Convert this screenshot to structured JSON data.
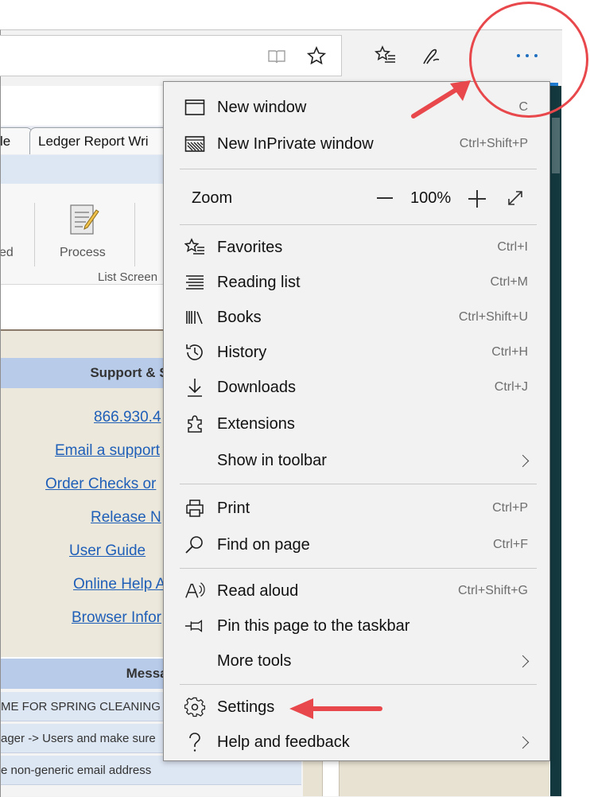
{
  "tabs": [
    {
      "label": "le"
    },
    {
      "label": "Ledger Report Wri"
    }
  ],
  "ribbon": {
    "items": [
      {
        "label": "ed"
      },
      {
        "label": "Process"
      }
    ],
    "group_label": "List Screen"
  },
  "support": {
    "header": "Support & Se",
    "links": [
      {
        "label": "866.930.4"
      },
      {
        "label": "Email a support"
      },
      {
        "label": "Order Checks or"
      },
      {
        "label": "Release N"
      },
      {
        "label": "User Guide"
      },
      {
        "label": "Online Help A"
      },
      {
        "label": "Browser Infor"
      }
    ]
  },
  "messages": {
    "header": "Messag",
    "lines": [
      {
        "text": "ME FOR SPRING CLEANING"
      },
      {
        "text": "ager -> Users and make sure"
      },
      {
        "text": "e non-generic email address"
      }
    ]
  },
  "menu": {
    "items_top": [
      {
        "label": "New window",
        "shortcut": "C",
        "icon": "window-icon"
      },
      {
        "label": "New InPrivate window",
        "shortcut": "Ctrl+Shift+P",
        "icon": "inprivate-icon"
      }
    ],
    "zoom": {
      "label": "Zoom",
      "value": "100%"
    },
    "items_mid": [
      {
        "label": "Favorites",
        "shortcut": "Ctrl+I",
        "icon": "favorites-icon"
      },
      {
        "label": "Reading list",
        "shortcut": "Ctrl+M",
        "icon": "reading-list-icon"
      },
      {
        "label": "Books",
        "shortcut": "Ctrl+Shift+U",
        "icon": "books-icon"
      },
      {
        "label": "History",
        "shortcut": "Ctrl+H",
        "icon": "history-icon"
      },
      {
        "label": "Downloads",
        "shortcut": "Ctrl+J",
        "icon": "download-icon"
      },
      {
        "label": "Extensions",
        "shortcut": "",
        "icon": "extensions-icon"
      },
      {
        "label": "Show in toolbar",
        "shortcut": "",
        "icon": ""
      }
    ],
    "items_print": [
      {
        "label": "Print",
        "shortcut": "Ctrl+P",
        "icon": "print-icon"
      },
      {
        "label": "Find on page",
        "shortcut": "Ctrl+F",
        "icon": "search-icon"
      }
    ],
    "items_tools": [
      {
        "label": "Read aloud",
        "shortcut": "Ctrl+Shift+G",
        "icon": "read-aloud-icon"
      },
      {
        "label": "Pin this page to the taskbar",
        "shortcut": "",
        "icon": "pin-icon"
      },
      {
        "label": "More tools",
        "shortcut": "",
        "icon": ""
      }
    ],
    "items_bottom": [
      {
        "label": "Settings",
        "shortcut": "",
        "icon": "gear-icon"
      },
      {
        "label": "Help and feedback",
        "shortcut": "",
        "icon": "help-icon"
      }
    ]
  },
  "colors": {
    "accent": "#1f7cd3",
    "annotation": "#e8484b",
    "link": "#1f5fb8"
  }
}
